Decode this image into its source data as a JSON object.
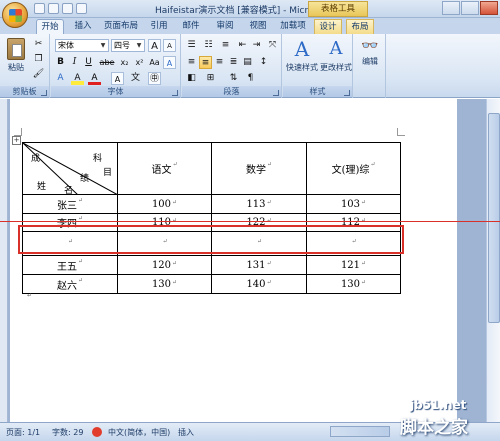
{
  "titlebar": {
    "title": "Haifeistar演示文档 [兼容模式] - Microsoft Word",
    "context_tab_title": "表格工具"
  },
  "tabs": [
    {
      "label": "开始",
      "active": true
    },
    {
      "label": "插入"
    },
    {
      "label": "页面布局"
    },
    {
      "label": "引用"
    },
    {
      "label": "邮件"
    },
    {
      "label": "审阅"
    },
    {
      "label": "视图"
    },
    {
      "label": "加载项"
    },
    {
      "label": "设计",
      "contextual": true
    },
    {
      "label": "布局",
      "contextual": true
    }
  ],
  "ribbon": {
    "clipboard": {
      "label": "剪贴板",
      "paste": "粘贴"
    },
    "font": {
      "label": "字体",
      "family": "宋体",
      "size": "四号",
      "bold": "B",
      "italic": "I",
      "underline": "U",
      "strike": "abe",
      "subscript": "x₂",
      "superscript": "x²",
      "change_case": "Aa",
      "font_color": "A",
      "big_a": "A",
      "small_a": "A",
      "clear": "A",
      "phonetic": "A",
      "char_border": "A",
      "wen": "文"
    },
    "paragraph": {
      "label": "段落"
    },
    "styles": {
      "label": "样式",
      "quick_styles": "快速样式",
      "change_styles": "更改样式"
    },
    "editing": {
      "label": "编辑"
    }
  },
  "table": {
    "header_corner": {
      "cheng": "成",
      "ke": "科",
      "ji": "绩",
      "mu": "目",
      "xing": "姓",
      "ming": "名"
    },
    "columns": [
      "语文",
      "数学",
      "文(理)综"
    ],
    "rows": [
      {
        "name": "张三",
        "values": [
          "100",
          "113",
          "103"
        ]
      },
      {
        "name": "李四",
        "values": [
          "110",
          "122",
          "112"
        ]
      },
      {
        "name": "",
        "values": [
          "",
          "",
          ""
        ]
      },
      {
        "name": "王五",
        "values": [
          "120",
          "131",
          "121"
        ]
      },
      {
        "name": "赵六",
        "values": [
          "130",
          "140",
          "130"
        ]
      }
    ],
    "para_mark": "↵"
  },
  "statusbar": {
    "page": "页面: 1/1",
    "words": "字数: 29",
    "language": "中文(简体，中国)",
    "mode": "插入"
  },
  "watermark": {
    "site": "jb51.net",
    "name": "脚本之家"
  }
}
